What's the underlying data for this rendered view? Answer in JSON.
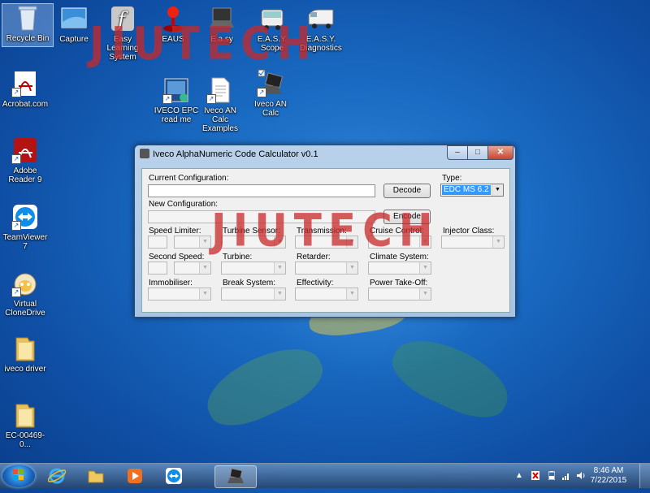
{
  "desktop": {
    "icons": [
      {
        "label": "Recycle Bin"
      },
      {
        "label": "Capture"
      },
      {
        "label": "Easy Learning System"
      },
      {
        "label": "EAUS"
      },
      {
        "label": "E.a.sy"
      },
      {
        "label": "E.A.S.Y. Scope"
      },
      {
        "label": "E.A.S.Y. Diagnostics"
      },
      {
        "label": "Acrobat.com"
      },
      {
        "label": "IVECO EPC read me"
      },
      {
        "label": "Iveco AN Calc Examples"
      },
      {
        "label": "Iveco AN Calc"
      },
      {
        "label": "Adobe Reader 9"
      },
      {
        "label": "TeamViewer 7"
      },
      {
        "label": "Virtual CloneDrive"
      },
      {
        "label": "iveco driver"
      },
      {
        "label": "EC-00469-0..."
      }
    ],
    "watermark": "JIUTECH"
  },
  "window": {
    "title": "Iveco AlphaNumeric Code Calculator v0.1",
    "current_config_label": "Current Configuration:",
    "current_config_value": "",
    "new_config_label": "New Configuration:",
    "new_config_value": "",
    "decode_button": "Decode",
    "encode_button": "Encode",
    "type_label": "Type:",
    "type_value": "EDC MS 6.2",
    "fields": {
      "speed_limiter": "Speed Limiter:",
      "turbine_sensor": "Turbine Sensor:",
      "transmission": "Transmission:",
      "cruise_control": "Cruise Control:",
      "injector_class": "Injector Class:",
      "second_speed": "Second Speed:",
      "turbine": "Turbine:",
      "retarder": "Retarder:",
      "climate_system": "Climate System:",
      "immobiliser": "Immobiliser:",
      "break_system": "Break System:",
      "effectivity": "Effectivity:",
      "power_take_off": "Power Take-Off:"
    }
  },
  "taskbar": {
    "time": "8:46 AM",
    "date": "7/22/2015"
  }
}
